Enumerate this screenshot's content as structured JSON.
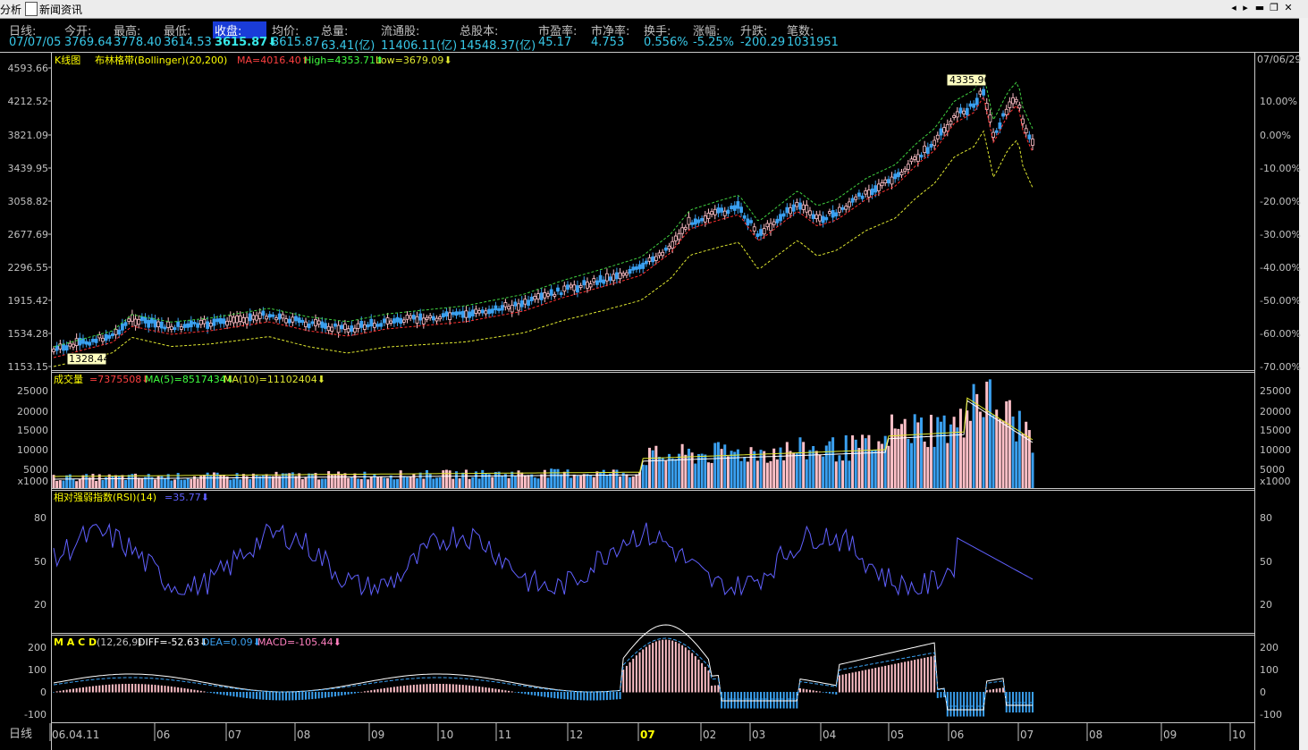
{
  "window": {
    "tab_analysis": "分析",
    "tab_news": "新闻资讯"
  },
  "quote": {
    "period_label": "日线:",
    "date": "07/07/05",
    "open_label": "今开:",
    "open": "3769.64",
    "high_label": "最高:",
    "high": "3778.40",
    "low_label": "最低:",
    "low": "3614.53",
    "close_label": "收盘:",
    "close": "3615.87⬇",
    "avg_label": "均价:",
    "avg": "3615.87",
    "vol_label": "总量:",
    "vol": "63.41(亿)",
    "float_label": "流通股:",
    "float": "11406.11(亿)",
    "total_label": "总股本:",
    "total": "14548.37(亿)",
    "pe_label": "市盈率:",
    "pe": "45.17",
    "pb_label": "市净率:",
    "pb": "4.753",
    "turn_label": "换手:",
    "turn": "0.556%",
    "chg_label": "涨幅:",
    "chg": "-5.25%",
    "diff_label": "升跌:",
    "diff": "-200.29",
    "deals_label": "笔数:",
    "deals": "1031951"
  },
  "kline": {
    "title": "K线图",
    "indicator": "布林格带(Bollinger)(20,200)",
    "ma": "MA=4016.40⬆",
    "high": "High=4353.71⬆",
    "low": "Low=3679.09⬇",
    "right_date": "07/06/29",
    "max_label": "4335.96",
    "min_label": "1328.44",
    "y_ticks": [
      "4593.66",
      "4212.52",
      "3821.09",
      "3439.95",
      "3058.82",
      "2677.69",
      "2296.55",
      "1915.42",
      "1534.28",
      "1153.15"
    ],
    "pct_ticks": [
      "10.00%",
      "0.00%",
      "-10.00%",
      "-20.00%",
      "-30.00%",
      "-40.00%",
      "-50.00%",
      "-60.00%",
      "-70.00%"
    ]
  },
  "volume": {
    "title": "成交量",
    "value": "=7375508⬇",
    "ma5": "MA(5)=8517434⬇",
    "ma10": "MA(10)=11102404⬇",
    "y_ticks": [
      "25000",
      "20000",
      "15000",
      "10000",
      "5000",
      "x1000"
    ]
  },
  "rsi": {
    "title": "相对强弱指数(RSI)(14)",
    "value": "=35.77⬇",
    "y_ticks": [
      "80",
      "50",
      "20"
    ]
  },
  "macd": {
    "title": "M A C D",
    "params": "(12,26,9)",
    "diff": "DIFF=-52.63⬇",
    "dea": "DEA=0.09⬇",
    "macd": "MACD=-105.44⬇",
    "y_ticks": [
      "200",
      "100",
      "0",
      "-100"
    ]
  },
  "xaxis": {
    "period": "日线",
    "labels": [
      "06.04.11",
      "06",
      "07",
      "08",
      "09",
      "10",
      "11",
      "12",
      "07",
      "02",
      "03",
      "04",
      "05",
      "06",
      "07",
      "08",
      "09",
      "10"
    ]
  },
  "colors": {
    "up": "#ffc0c8",
    "down": "#3aa0f0",
    "ma": "#ff3030",
    "band": "#e0e830",
    "rsi": "#6060ff"
  }
}
